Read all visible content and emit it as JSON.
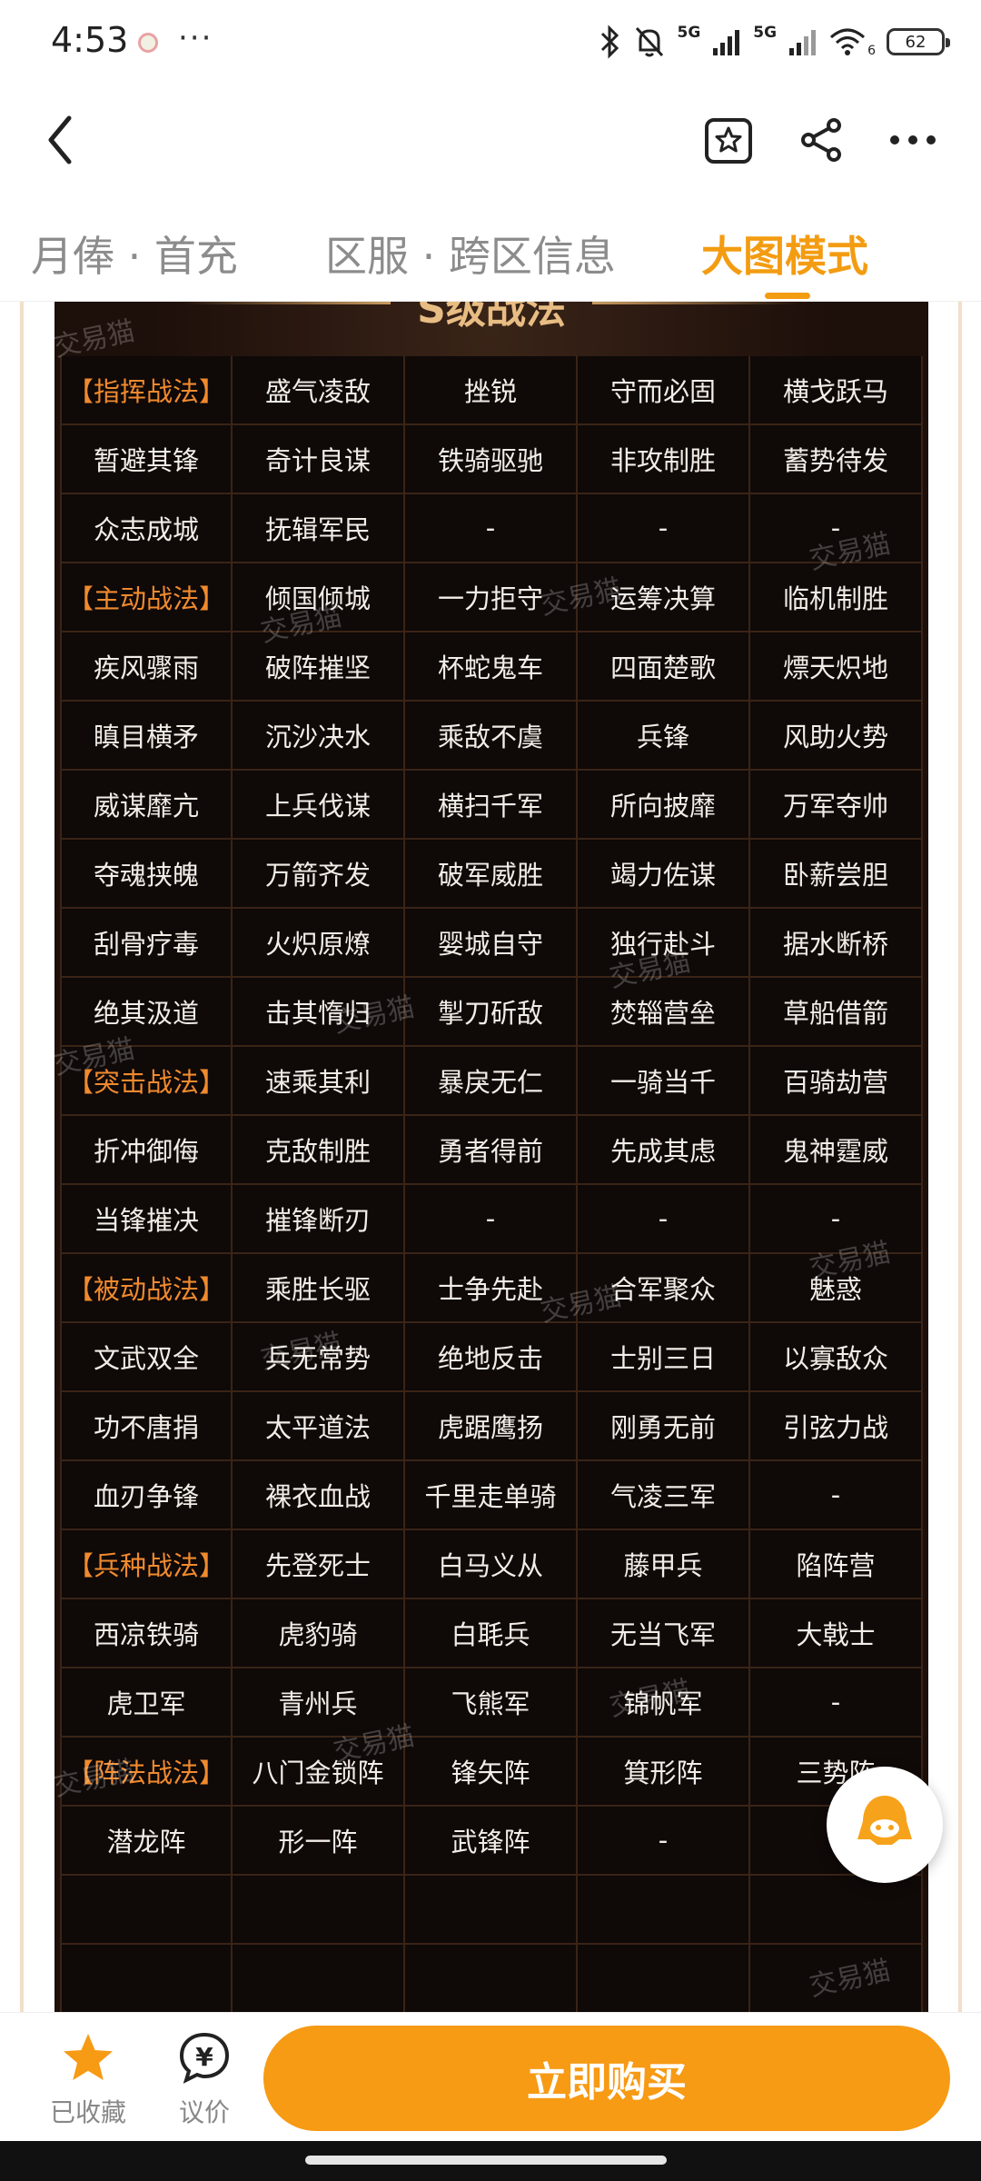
{
  "status_bar": {
    "time": "4:53",
    "more": "···",
    "network_label": "5G",
    "network_label_2": "5G",
    "wifi_sub": "6",
    "battery": "62"
  },
  "tabs": [
    {
      "label": "月俸 · 首充"
    },
    {
      "label": "区服 · 跨区信息"
    },
    {
      "label": "大图模式"
    }
  ],
  "panel": {
    "title": "S级战法",
    "watermark": "交易猫"
  },
  "grid": [
    [
      "【指挥战法】",
      "盛气凌敌",
      "挫锐",
      "守而必固",
      "横戈跃马"
    ],
    [
      "暂避其锋",
      "奇计良谋",
      "铁骑驱驰",
      "非攻制胜",
      "蓄势待发"
    ],
    [
      "众志成城",
      "抚辑军民",
      "-",
      "-",
      "-"
    ],
    [
      "【主动战法】",
      "倾国倾城",
      "一力拒守",
      "运筹决算",
      "临机制胜"
    ],
    [
      "疾风骤雨",
      "破阵摧坚",
      "杯蛇鬼车",
      "四面楚歌",
      "熛天炽地"
    ],
    [
      "瞋目横矛",
      "沉沙决水",
      "乘敌不虞",
      "兵锋",
      "风助火势"
    ],
    [
      "威谋靡亢",
      "上兵伐谋",
      "横扫千军",
      "所向披靡",
      "万军夺帅"
    ],
    [
      "夺魂挟魄",
      "万箭齐发",
      "破军威胜",
      "竭力佐谋",
      "卧薪尝胆"
    ],
    [
      "刮骨疗毒",
      "火炽原燎",
      "婴城自守",
      "独行赴斗",
      "据水断桥"
    ],
    [
      "绝其汲道",
      "击其惰归",
      "掣刀斫敌",
      "焚辎营垒",
      "草船借箭"
    ],
    [
      "【突击战法】",
      "速乘其利",
      "暴戾无仁",
      "一骑当千",
      "百骑劫营"
    ],
    [
      "折冲御侮",
      "克敌制胜",
      "勇者得前",
      "先成其虑",
      "鬼神霆威"
    ],
    [
      "当锋摧决",
      "摧锋断刃",
      "-",
      "-",
      "-"
    ],
    [
      "【被动战法】",
      "乘胜长驱",
      "士争先赴",
      "合军聚众",
      "魅惑"
    ],
    [
      "文武双全",
      "兵无常势",
      "绝地反击",
      "士别三日",
      "以寡敌众"
    ],
    [
      "功不唐捐",
      "太平道法",
      "虎踞鹰扬",
      "刚勇无前",
      "引弦力战"
    ],
    [
      "血刃争锋",
      "裸衣血战",
      "千里走单骑",
      "气凌三军",
      "-"
    ],
    [
      "【兵种战法】",
      "先登死士",
      "白马义从",
      "藤甲兵",
      "陷阵营"
    ],
    [
      "西凉铁骑",
      "虎豹骑",
      "白毦兵",
      "无当飞军",
      "大戟士"
    ],
    [
      "虎卫军",
      "青州兵",
      "飞熊军",
      "锦帆军",
      "-"
    ],
    [
      "【阵法战法】",
      "八门金锁阵",
      "锋矢阵",
      "箕形阵",
      "三势阵"
    ],
    [
      "潜龙阵",
      "形一阵",
      "武锋阵",
      "-",
      ""
    ],
    [
      "",
      "",
      "",
      "",
      ""
    ],
    [
      "",
      "",
      "",
      "",
      ""
    ]
  ],
  "bottom_bar": {
    "favorite_label": "已收藏",
    "bargain_label": "议价",
    "bargain_glyph": "¥",
    "buy_label": "立即购买"
  },
  "colors": {
    "accent": "#f39c12",
    "buy_button": "#f79a14",
    "category_text": "#f08a2e",
    "panel_bg": "#1d0f0a"
  }
}
